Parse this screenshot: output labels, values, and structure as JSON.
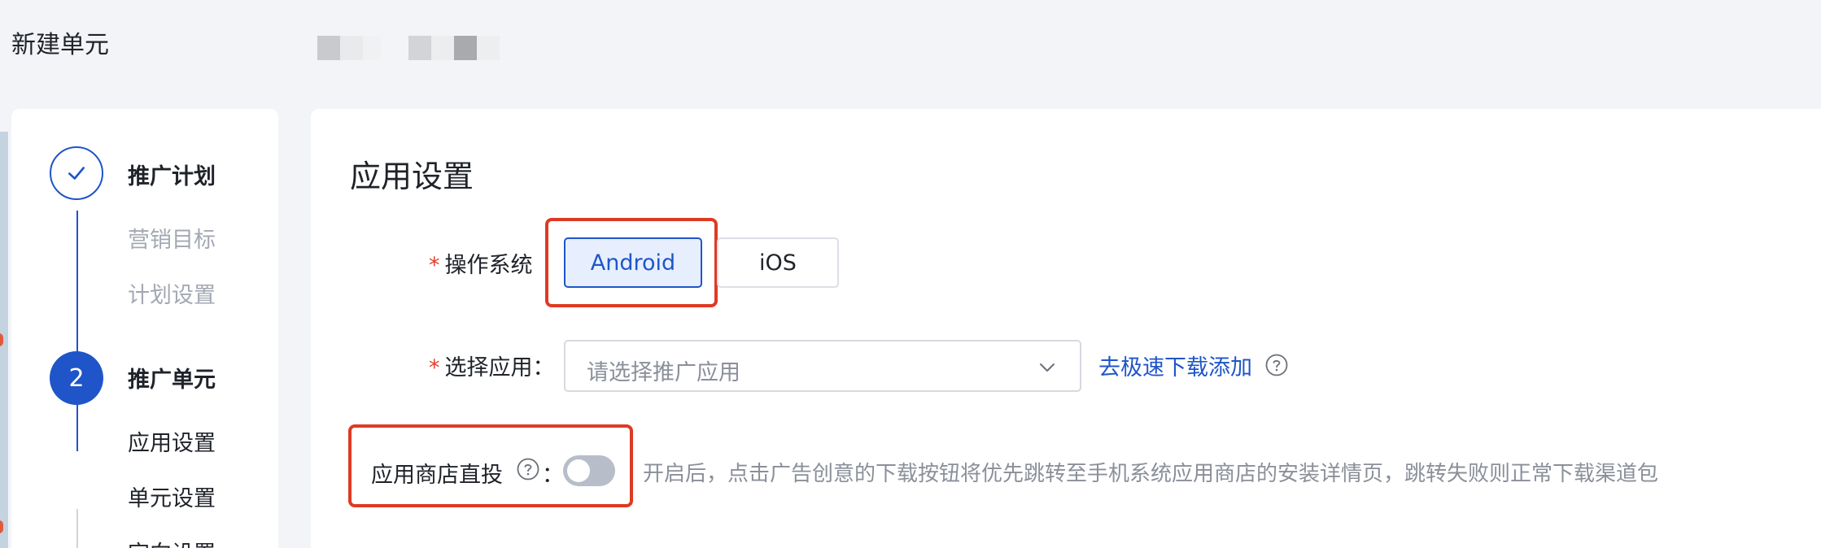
{
  "header": {
    "title": "新建单元"
  },
  "steps": {
    "plan": {
      "title": "推广计划",
      "items": [
        "营销目标",
        "计划设置"
      ]
    },
    "unit": {
      "number": "2",
      "title": "推广单元",
      "items": [
        "应用设置",
        "单元设置",
        "定向设置"
      ]
    }
  },
  "main": {
    "section_title": "应用设置",
    "os": {
      "required_mark": "*",
      "label": "操作系统",
      "options": [
        "Android",
        "iOS"
      ],
      "selected": "Android"
    },
    "app_select": {
      "required_mark": "*",
      "label": "选择应用",
      "colon": "：",
      "placeholder": "请选择推广应用",
      "link": "去极速下载添加"
    },
    "store_direct": {
      "label": "应用商店直投",
      "colon": "：",
      "enabled": false,
      "description": "开启后，点击广告创意的下载按钮将优先跳转至手机系统应用商店的安装详情页，跳转失败则正常下载渠道包"
    }
  },
  "colors": {
    "primary": "#1f55c9",
    "highlight": "#de3a23",
    "required": "#e2402d"
  }
}
